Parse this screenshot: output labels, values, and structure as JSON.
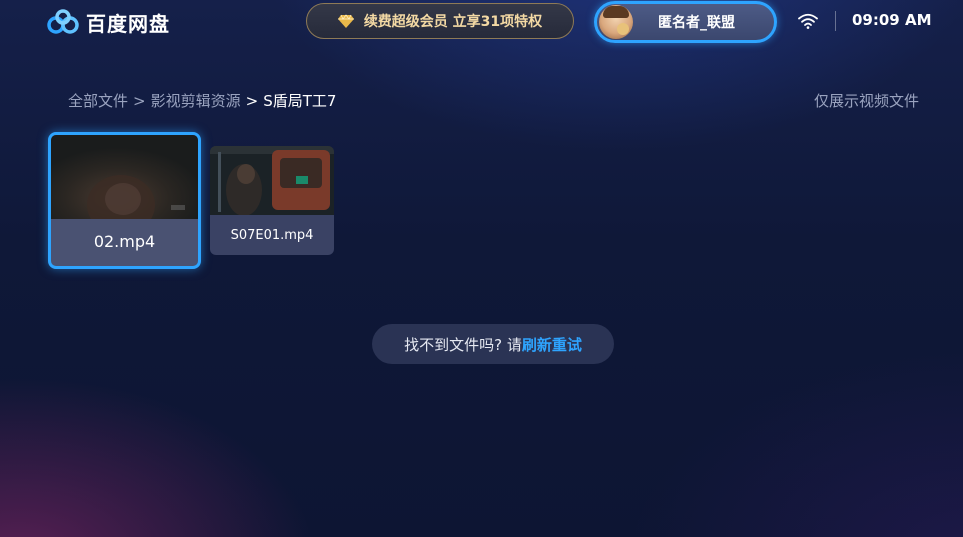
{
  "header": {
    "app_name": "百度网盘",
    "logo_icon": "baidu-netdisk-logo-icon",
    "vip_banner": {
      "icon": "vip-diamond-icon",
      "text": "续费超级会员 立享31项特权"
    },
    "user": {
      "avatar": "avatar",
      "name": "匿名者_联盟"
    },
    "wifi_icon": "wifi-icon",
    "time": "09:09 AM"
  },
  "breadcrumb": {
    "items": [
      "全部文件",
      "影视剪辑资源",
      "S盾局T工7"
    ],
    "separator": ">"
  },
  "filter": {
    "label": "仅展示视频文件"
  },
  "files": [
    {
      "name": "02.mp4",
      "selected": true
    },
    {
      "name": "S07E01.mp4",
      "selected": false
    }
  ],
  "empty_hint": {
    "text": "找不到文件吗? 请",
    "link": "刷新重试"
  },
  "colors": {
    "accent": "#2ea4ff",
    "vip_gold": "#f3d9a4",
    "background": "#0f1838"
  }
}
